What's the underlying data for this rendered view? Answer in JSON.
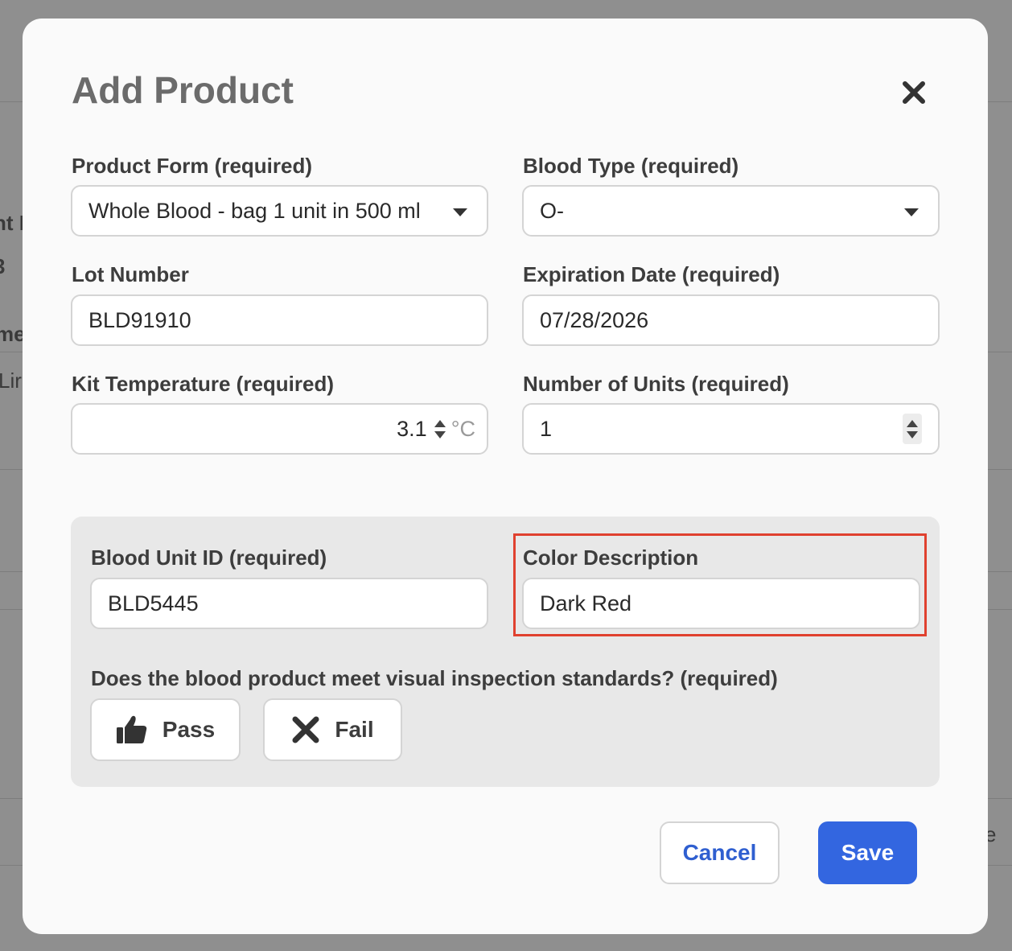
{
  "modal": {
    "title": "Add Product"
  },
  "form": {
    "product_form": {
      "label": "Product Form (required)",
      "value": "Whole Blood - bag 1 unit in 500 ml"
    },
    "blood_type": {
      "label": "Blood Type (required)",
      "value": "O-"
    },
    "lot_number": {
      "label": "Lot Number",
      "value": "BLD91910"
    },
    "expiration_date": {
      "label": "Expiration Date (required)",
      "value": "07/28/2026"
    },
    "kit_temperature": {
      "label": "Kit Temperature (required)",
      "value": "3.1",
      "unit": "°C"
    },
    "number_of_units": {
      "label": "Number of Units (required)",
      "value": "1"
    }
  },
  "inspection": {
    "blood_unit_id": {
      "label": "Blood Unit ID (required)",
      "value": "BLD5445"
    },
    "color_description": {
      "label": "Color Description",
      "value": "Dark Red"
    },
    "question": "Does the blood product meet visual inspection standards? (required)",
    "pass_label": "Pass",
    "fail_label": "Fail"
  },
  "actions": {
    "cancel_label": "Cancel",
    "save_label": "Save"
  },
  "colors": {
    "accent": "#3366e0",
    "highlight": "#e0412f"
  },
  "background": {
    "fragments": [
      "nt I",
      "3",
      "me",
      "Lir",
      "e"
    ]
  }
}
